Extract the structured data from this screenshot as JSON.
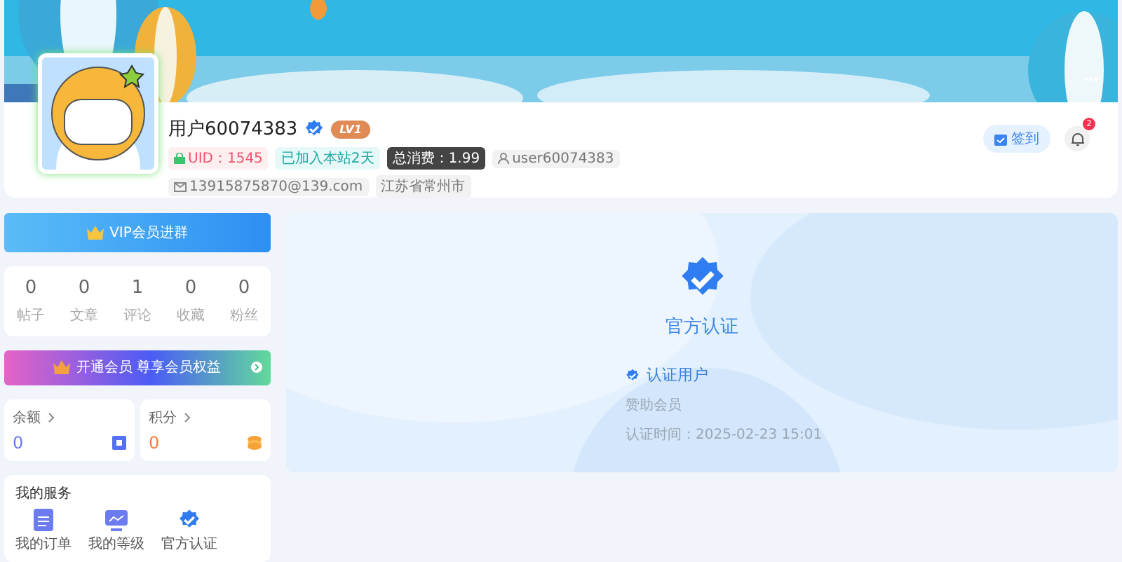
{
  "profile": {
    "name": "用户60074383",
    "verified": true,
    "level": "LV1",
    "tags": [
      {
        "kind": "uid",
        "text": "UID：1545"
      },
      {
        "kind": "joined",
        "text": "已加入本站2天"
      },
      {
        "kind": "spent",
        "text": "总消费：1.99"
      },
      {
        "kind": "username",
        "text": "user60074383"
      },
      {
        "kind": "email",
        "text": "13915875870@139.com"
      },
      {
        "kind": "location",
        "text": "江苏省常州市"
      }
    ],
    "checkin": "签到",
    "notification_count": "2"
  },
  "vip_button": "VIP会员进群",
  "stats": [
    {
      "value": "0",
      "label": "帖子"
    },
    {
      "value": "0",
      "label": "文章"
    },
    {
      "value": "1",
      "label": "评论"
    },
    {
      "value": "0",
      "label": "收藏"
    },
    {
      "value": "0",
      "label": "粉丝"
    }
  ],
  "membership_banner": "开通会员 尊享会员权益",
  "wallet": [
    {
      "kind": "balance",
      "label": "余额",
      "value": "0"
    },
    {
      "kind": "points",
      "label": "积分",
      "value": "0"
    }
  ],
  "services": {
    "title": "我的服务",
    "items": [
      {
        "kind": "orders",
        "label": "我的订单"
      },
      {
        "kind": "level",
        "label": "我的等级"
      },
      {
        "kind": "verify",
        "label": "官方认证"
      }
    ]
  },
  "certification": {
    "title": "官方认证",
    "type": "认证用户",
    "member": "赞助会员",
    "time": "认证时间：2025-02-23 15:01"
  }
}
